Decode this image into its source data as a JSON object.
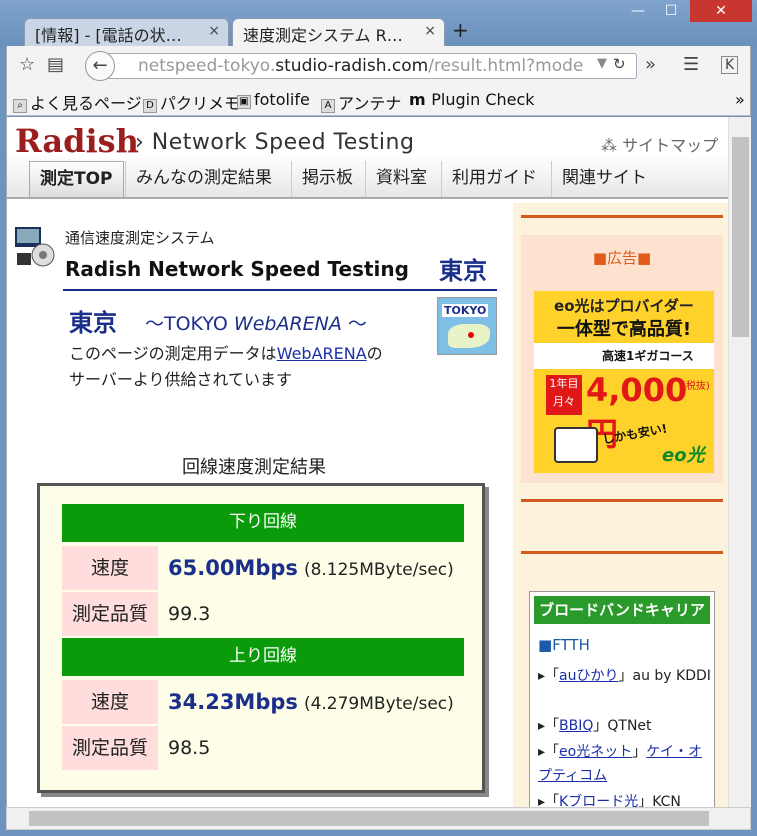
{
  "browser": {
    "tab_inactive": "[情報] - [電話の状…",
    "tab_active": "速度測定システム R…",
    "tab_close": "×",
    "new_tab": "+",
    "url_prefix": "netspeed-tokyo.",
    "url_domain": "studio-radish.com",
    "url_path": "/result.html?mode",
    "bookmarks": [
      "よく見るページ",
      "パクリメモ",
      "fotolife",
      "アンテナ",
      "Plugin Check"
    ],
    "bookmark_more": "»"
  },
  "header": {
    "logo": "Radish",
    "subtitle": "Network Speed Testing",
    "sitemap": "サイトマップ"
  },
  "menu": [
    "測定TOP",
    "みんなの測定結果",
    "掲示板",
    "資料室",
    "利用ガイド",
    "関連サイト"
  ],
  "intro": {
    "system_label": "通信速度測定システム",
    "title": "Radish Network Speed Testing",
    "location": "東京",
    "city": "東京",
    "city_en_prefix": "～TOKYO ",
    "city_en_italic": "WebARENA",
    "city_en_suffix": " ～",
    "desc_1": "このページの測定用データは",
    "desc_link": "WebARENA",
    "desc_2": "の",
    "desc_3": "サーバーより供給されています",
    "map_label": "TOKYO"
  },
  "result": {
    "title": "回線速度測定結果",
    "down_header": "下り回線",
    "down_speed_label": "速度",
    "down_speed": "65.00Mbps",
    "down_bytes": "(8.125MByte/sec)",
    "down_quality_label": "測定品質",
    "down_quality": "99.3",
    "up_header": "上り回線",
    "up_speed_label": "速度",
    "up_speed": "34.23Mbps",
    "up_bytes": "(4.279MByte/sec)",
    "up_quality_label": "測定品質",
    "up_quality": "98.5"
  },
  "sidebar": {
    "ad_heading": "■広告■",
    "ad": {
      "line1": "eo光はプロバイダー",
      "line2": "一体型で高品質!",
      "line3": "高速1ギガコース",
      "tag": "1年目 月々",
      "price": "4,000円",
      "tax": "(税抜)",
      "callout": "しかも安い!",
      "brand": "eo光"
    },
    "carrier_heading": "ブロードバンドキャリア",
    "carrier_sub": "■FTTH",
    "carriers": [
      {
        "link": "auひかり",
        "text": "au by KDDI"
      },
      {
        "link": "BBIQ",
        "text": "QTNet"
      },
      {
        "link": "eo光ネット",
        "text": "ケイ・オプティコム"
      },
      {
        "link": "Kブロード光",
        "text": "KCN"
      }
    ]
  },
  "colors": {
    "accent_green": "#0a9a0a",
    "link_blue": "#1a2fa8",
    "brand_red": "#9b1d1d"
  }
}
